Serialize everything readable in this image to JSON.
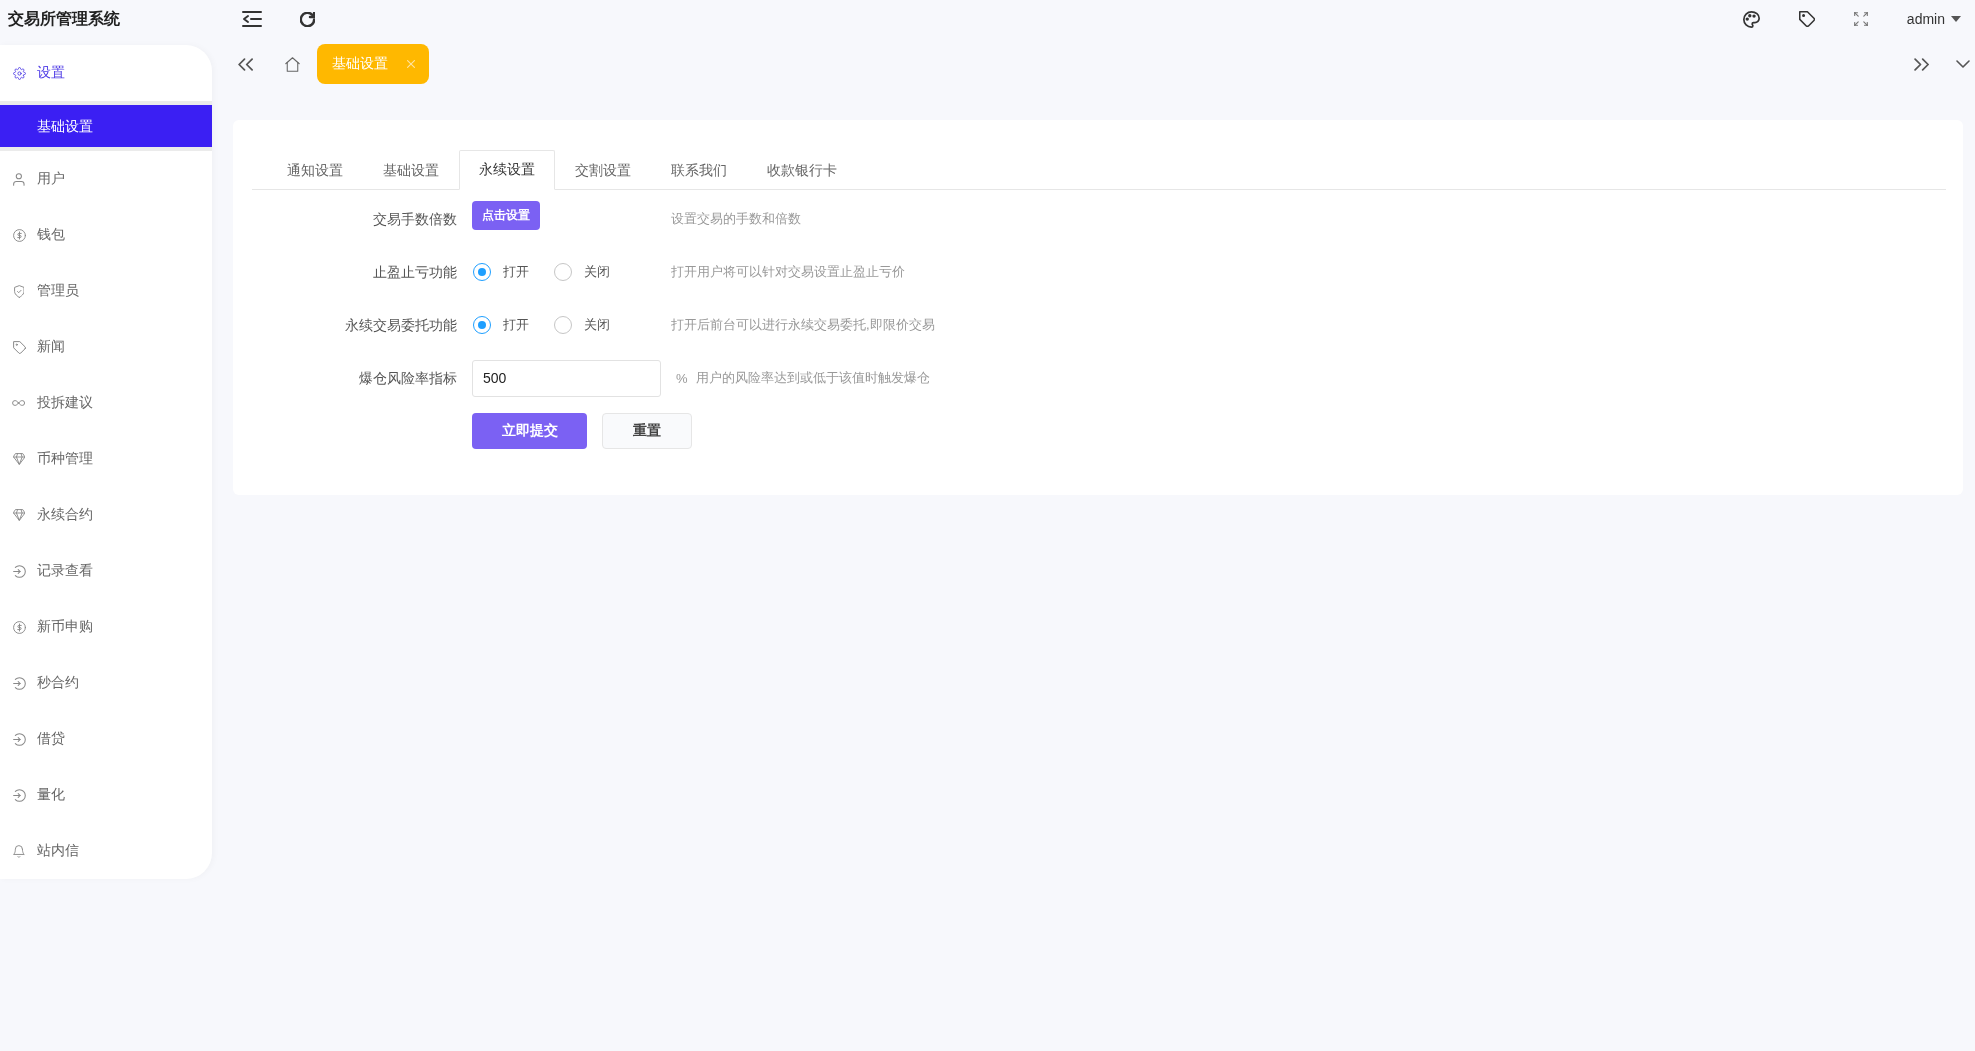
{
  "header": {
    "title": "交易所管理系统",
    "user": "admin"
  },
  "sidebar": {
    "items": [
      {
        "label": "设置",
        "expanded": true,
        "children": [
          {
            "label": "基础设置",
            "selected": true
          }
        ]
      },
      {
        "label": "用户",
        "expanded": false
      },
      {
        "label": "钱包",
        "expanded": false
      },
      {
        "label": "管理员",
        "expanded": false
      },
      {
        "label": "新闻",
        "expanded": false
      },
      {
        "label": "投拆建议",
        "expanded": false
      },
      {
        "label": "币种管理",
        "expanded": false
      },
      {
        "label": "永续合约",
        "expanded": false
      },
      {
        "label": "记录查看",
        "expanded": false
      },
      {
        "label": "新币申购",
        "expanded": false
      },
      {
        "label": "秒合约",
        "expanded": false
      },
      {
        "label": "借贷",
        "expanded": false
      },
      {
        "label": "量化",
        "expanded": false
      },
      {
        "label": "站内信",
        "expanded": false
      }
    ]
  },
  "page_tabs": [
    {
      "label": "基础设置",
      "selected": true
    }
  ],
  "settings_tabs": [
    {
      "label": "通知设置",
      "selected": false
    },
    {
      "label": "基础设置",
      "selected": false
    },
    {
      "label": "永续设置",
      "selected": true
    },
    {
      "label": "交割设置",
      "selected": false
    },
    {
      "label": "联系我们",
      "selected": false
    },
    {
      "label": "收款银行卡",
      "selected": false
    }
  ],
  "form": {
    "rows": [
      {
        "kind": "button",
        "label": "交易手数倍数",
        "button": "点击设置",
        "help": "设置交易的手数和倍数"
      },
      {
        "kind": "radio",
        "label": "止盈止亏功能",
        "options": [
          {
            "label": "打开",
            "selected": true
          },
          {
            "label": "关闭",
            "selected": false
          }
        ],
        "help": "打开用户将可以针对交易设置止盈止亏价"
      },
      {
        "kind": "radio",
        "label": "永续交易委托功能",
        "options": [
          {
            "label": "打开",
            "selected": true
          },
          {
            "label": "关闭",
            "selected": false
          }
        ],
        "help": "打开后前台可以进行永续交易委托,即限价交易"
      },
      {
        "kind": "input",
        "label": "爆仓风险率指标",
        "value": "500",
        "unit": "%",
        "help": "用户的风险率达到或低于该值时触发爆仓"
      }
    ],
    "actions": [
      {
        "kind": "primary",
        "label": "立即提交"
      },
      {
        "kind": "default",
        "label": "重置"
      }
    ]
  }
}
